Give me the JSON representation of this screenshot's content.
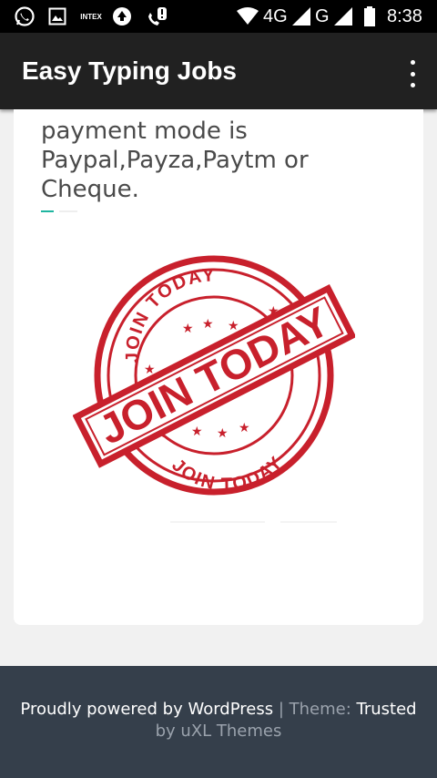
{
  "status_bar": {
    "icons": [
      "whatsapp-icon",
      "gallery-icon",
      "intex-icon",
      "upload-icon",
      "missed-call-icon",
      "wifi-icon",
      "signal-icon",
      "battery-icon"
    ],
    "brand_text": "INTEX",
    "network_4g": "4G",
    "network_g": "G",
    "time": "8:38"
  },
  "app_bar": {
    "title": "Easy Typing Jobs",
    "menu_icon": "more-vert-icon"
  },
  "content": {
    "paragraph": "payment mode is Paypal,Payza,Paytm or Cheque.",
    "image": {
      "icon": "join-today-stamp",
      "top_text": "JOIN TODAY",
      "center_text": "JOIN TODAY",
      "bottom_text": "JOIN TODAY",
      "color": "#c8202c"
    }
  },
  "footer": {
    "powered_prefix": "Proudly powered by WordPress",
    "separator": " | ",
    "theme_label": "Theme: ",
    "theme_name": "Trusted",
    "by_text": "by uXL Themes"
  },
  "colors": {
    "status_bar": "#000000",
    "app_bar": "#212121",
    "background": "#f1f1f1",
    "accent": "#1fb5a0",
    "footer": "#353f4b"
  }
}
